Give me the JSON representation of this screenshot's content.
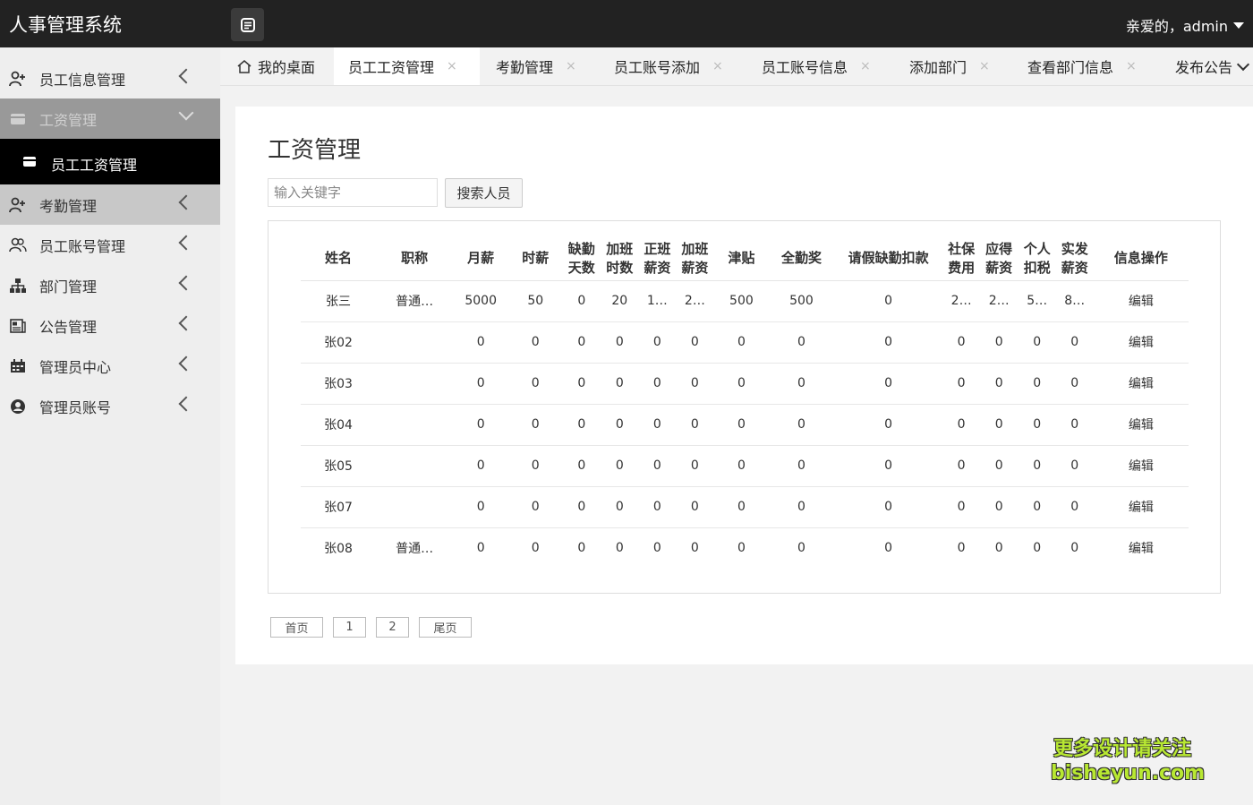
{
  "header": {
    "title": "人事管理系统",
    "greeting": "亲爱的，admin"
  },
  "sidebar": {
    "items": [
      {
        "label": "员工信息管理",
        "icon": "user-add-icon"
      },
      {
        "label": "工资管理",
        "icon": "card-icon"
      },
      {
        "label": "考勤管理",
        "icon": "user-add-icon"
      },
      {
        "label": "员工账号管理",
        "icon": "users-icon"
      },
      {
        "label": "部门管理",
        "icon": "sitemap-icon"
      },
      {
        "label": "公告管理",
        "icon": "newspaper-icon"
      },
      {
        "label": "管理员中心",
        "icon": "calendar-icon"
      },
      {
        "label": "管理员账号",
        "icon": "user-circle-icon"
      }
    ],
    "sub_item": {
      "label": "员工工资管理",
      "icon": "card-icon"
    }
  },
  "tabs": [
    {
      "label": "我的桌面"
    },
    {
      "label": "员工工资管理"
    },
    {
      "label": "考勤管理"
    },
    {
      "label": "员工账号添加"
    },
    {
      "label": "员工账号信息"
    },
    {
      "label": "添加部门"
    },
    {
      "label": "查看部门信息"
    },
    {
      "label": "发布公告"
    }
  ],
  "tab_close": "×",
  "main": {
    "title": "工资管理",
    "search_placeholder": "输入关键字",
    "search_button": "搜索人员"
  },
  "table": {
    "headers": [
      [
        "姓名"
      ],
      [
        "职称"
      ],
      [
        "月薪"
      ],
      [
        "时薪"
      ],
      [
        "缺勤",
        "天数"
      ],
      [
        "加班",
        "时数"
      ],
      [
        "正班",
        "薪资"
      ],
      [
        "加班",
        "薪资"
      ],
      [
        "津贴"
      ],
      [
        "全勤奖"
      ],
      [
        "请假缺勤扣款"
      ],
      [
        "社保",
        "费用"
      ],
      [
        "应得",
        "薪资"
      ],
      [
        "个人",
        "扣税"
      ],
      [
        "实发",
        "薪资"
      ],
      [
        "信息操作"
      ]
    ],
    "rows": [
      [
        "张三",
        "普通…",
        "5000",
        "50",
        "0",
        "20",
        "1…",
        "2…",
        "500",
        "500",
        "0",
        "2…",
        "2…",
        "5…",
        "8…",
        "编辑"
      ],
      [
        "张02",
        "",
        "0",
        "0",
        "0",
        "0",
        "0",
        "0",
        "0",
        "0",
        "0",
        "0",
        "0",
        "0",
        "0",
        "编辑"
      ],
      [
        "张03",
        "",
        "0",
        "0",
        "0",
        "0",
        "0",
        "0",
        "0",
        "0",
        "0",
        "0",
        "0",
        "0",
        "0",
        "编辑"
      ],
      [
        "张04",
        "",
        "0",
        "0",
        "0",
        "0",
        "0",
        "0",
        "0",
        "0",
        "0",
        "0",
        "0",
        "0",
        "0",
        "编辑"
      ],
      [
        "张05",
        "",
        "0",
        "0",
        "0",
        "0",
        "0",
        "0",
        "0",
        "0",
        "0",
        "0",
        "0",
        "0",
        "0",
        "编辑"
      ],
      [
        "张07",
        "",
        "0",
        "0",
        "0",
        "0",
        "0",
        "0",
        "0",
        "0",
        "0",
        "0",
        "0",
        "0",
        "0",
        "编辑"
      ],
      [
        "张08",
        "普通…",
        "0",
        "0",
        "0",
        "0",
        "0",
        "0",
        "0",
        "0",
        "0",
        "0",
        "0",
        "0",
        "0",
        "编辑"
      ]
    ]
  },
  "pager": {
    "first": "首页",
    "pages": [
      "1",
      "2"
    ],
    "last": "尾页"
  },
  "watermark": {
    "line1": "更多设计请关注",
    "line2": "bisheyun.com"
  },
  "colors": {
    "header_bg": "#222222",
    "link": "#1e7ab5",
    "sidebar_active": "#999999"
  }
}
